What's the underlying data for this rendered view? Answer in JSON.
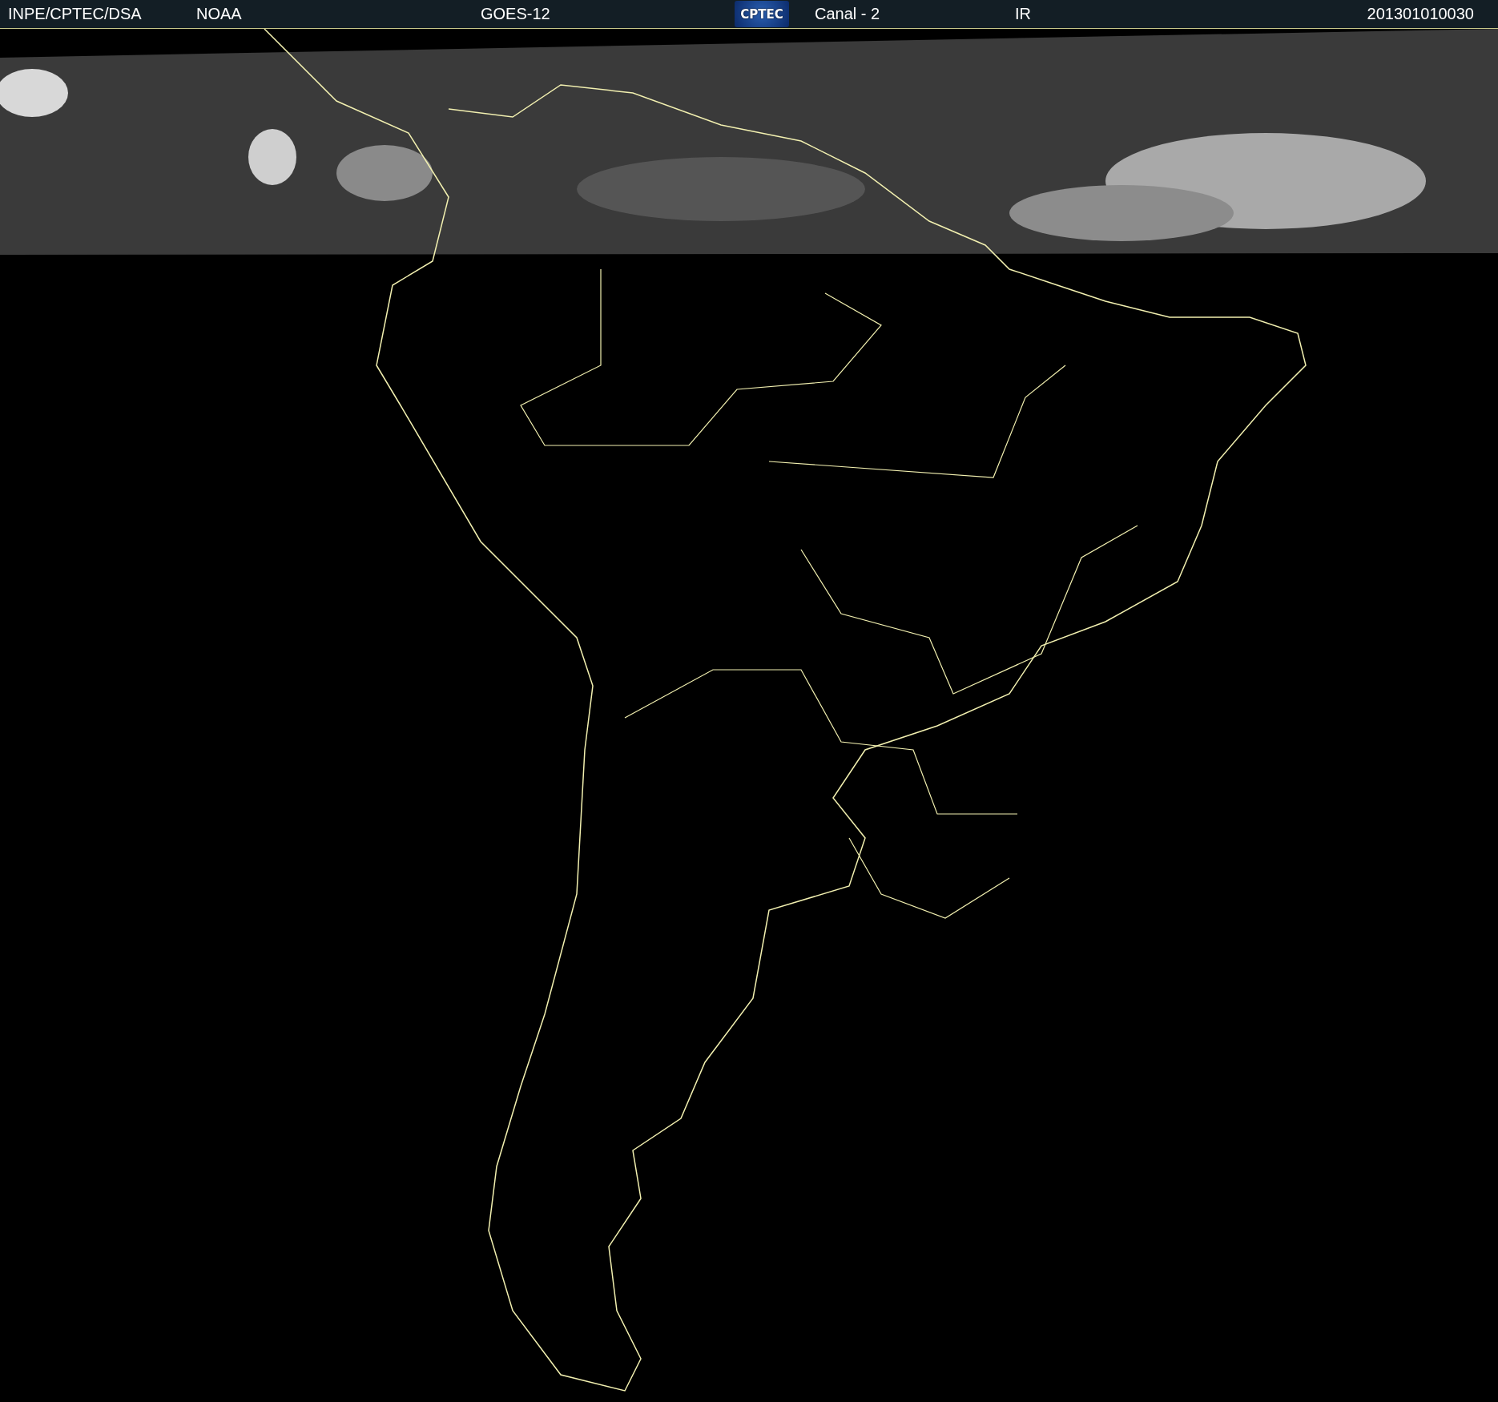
{
  "header": {
    "source": "INPE/CPTEC/DSA",
    "agency": "NOAA",
    "satellite": "GOES-12",
    "logo": "CPTEC",
    "channel": "Canal - 2",
    "band": "IR",
    "timestamp": "201301010030"
  }
}
